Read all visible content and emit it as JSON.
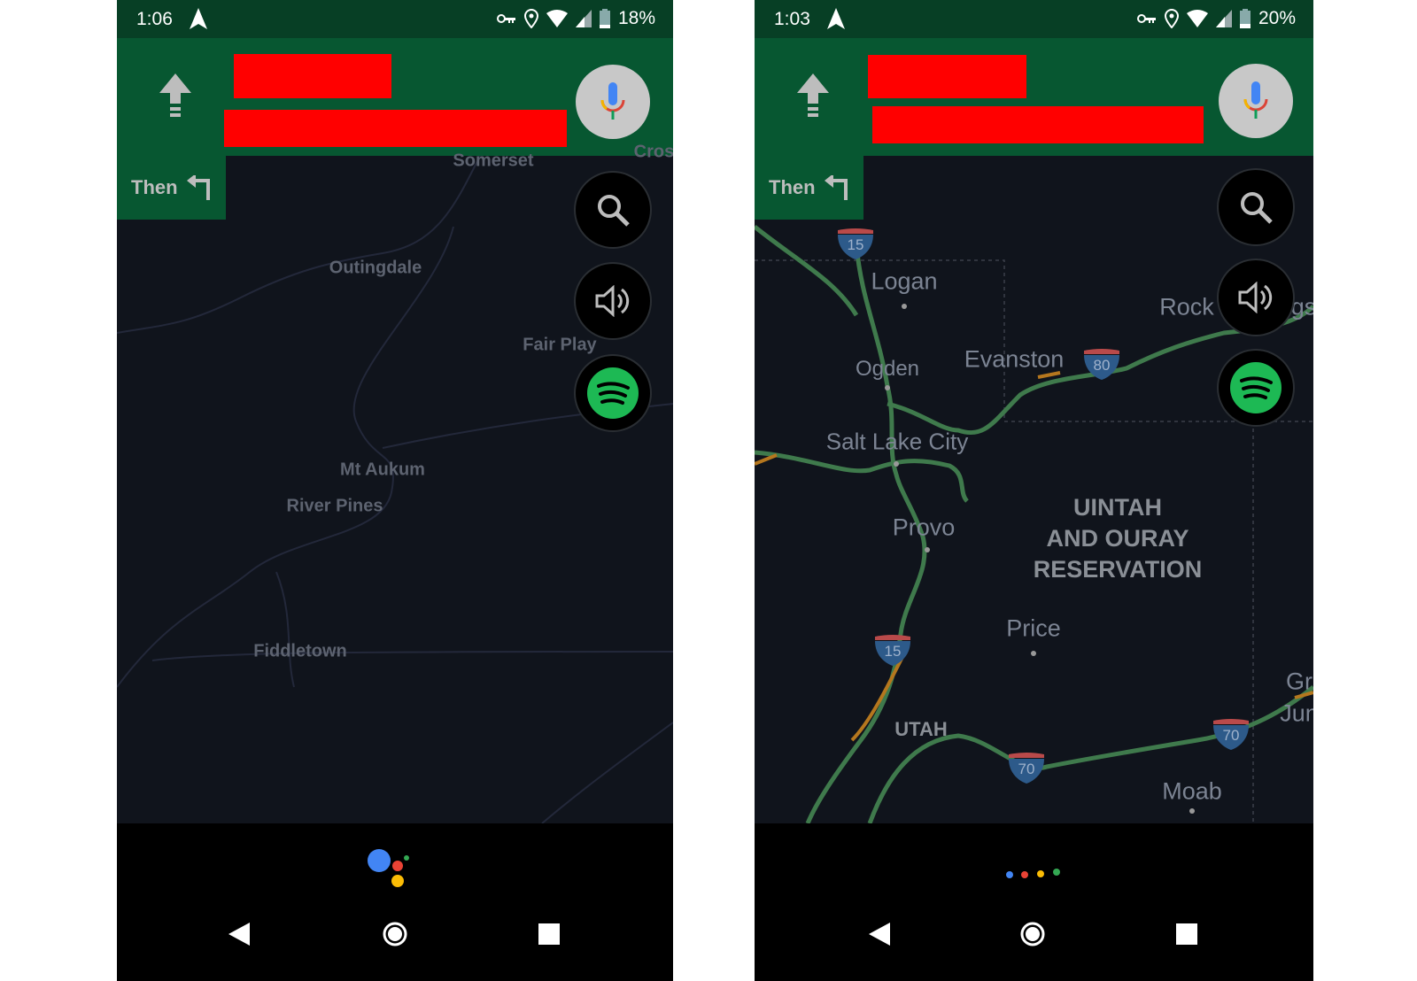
{
  "screens": [
    {
      "status": {
        "time": "1:06",
        "battery": "18%"
      },
      "then_label": "Then",
      "map_labels": [
        {
          "text": "Somerset"
        },
        {
          "text": "Cross"
        },
        {
          "text": "Outingdale"
        },
        {
          "text": "Fair Play"
        },
        {
          "text": "Mt Aukum"
        },
        {
          "text": "River Pines"
        },
        {
          "text": "Fiddletown"
        }
      ],
      "assistant_state": "listening"
    },
    {
      "status": {
        "time": "1:03",
        "battery": "20%"
      },
      "then_label": "Then",
      "map_labels": [
        {
          "text": "Logan"
        },
        {
          "text": "Ogden"
        },
        {
          "text": "Evanston"
        },
        {
          "text": "Salt Lake City"
        },
        {
          "text": "Provo"
        },
        {
          "text": "Rock"
        },
        {
          "text": "Price"
        },
        {
          "text": "Moab"
        },
        {
          "text": "Gr"
        },
        {
          "text": "Jun"
        },
        {
          "text": "gs"
        }
      ],
      "region_label": "UINTAH AND OURAY RESERVATION",
      "state_label": "UTAH",
      "shields": [
        "15",
        "80",
        "15",
        "70",
        "70"
      ],
      "assistant_state": "thinking"
    }
  ],
  "icons": {
    "turn": "straight-arrow-icon",
    "then_turn": "turn-left-icon",
    "mic": "mic-icon",
    "search": "search-icon",
    "volume": "volume-icon",
    "spotify": "spotify-icon"
  },
  "colors": {
    "header": "#075731",
    "status": "#073f25",
    "road": "#3f7a4c",
    "redaction": "#ff0000",
    "spotify": "#1db954"
  }
}
